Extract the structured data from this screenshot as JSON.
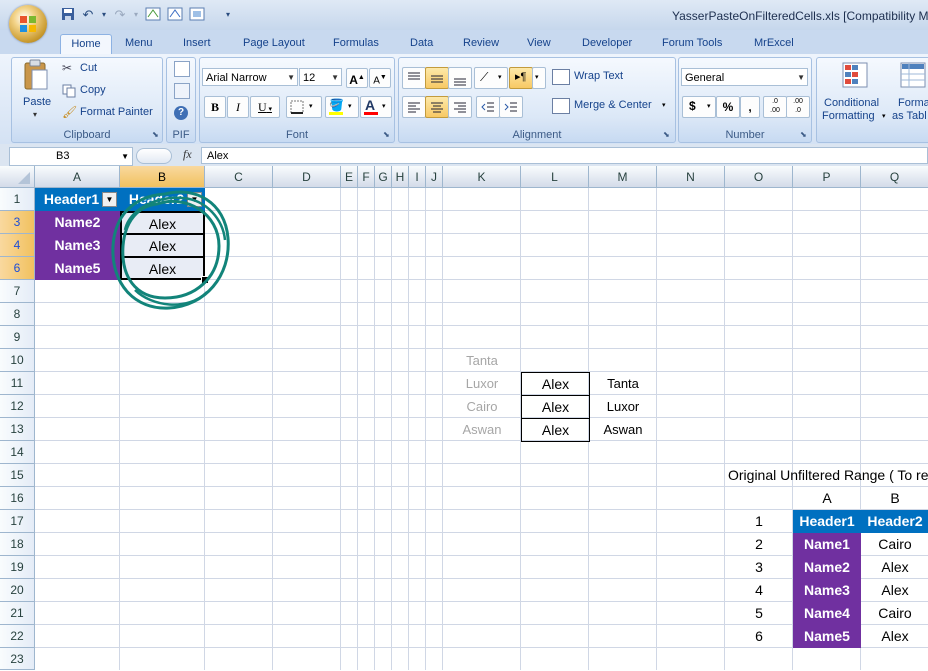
{
  "window": {
    "title": "YasserPasteOnFilteredCells.xls  [Compatibility M"
  },
  "tabs": [
    "Home",
    "Menu",
    "Insert",
    "Page Layout",
    "Formulas",
    "Data",
    "Review",
    "View",
    "Developer",
    "Forum Tools",
    "MrExcel"
  ],
  "active_tab": "Home",
  "ribbon": {
    "clipboard": {
      "paste": "Paste",
      "cut": "Cut",
      "copy": "Copy",
      "format_painter": "Format Painter",
      "label": "Clipboard"
    },
    "pif": {
      "label": "PIF"
    },
    "font": {
      "name": "Arial Narrow",
      "size": "12",
      "label": "Font",
      "bold": "B",
      "italic": "I",
      "underline": "U",
      "grow": "A",
      "shrink": "A",
      "font_color": "A"
    },
    "alignment": {
      "wrap_text": "Wrap Text",
      "merge_center": "Merge & Center",
      "label": "Alignment"
    },
    "number": {
      "format": "General",
      "currency": "$",
      "percent": "%",
      "comma": ",",
      "label": "Number",
      "inc_decimal": ".0 .00",
      "dec_decimal": ".00 .0"
    },
    "styles": {
      "conditional_1": "Conditional",
      "conditional_2": "Formatting",
      "format_as_1": "Format",
      "format_as_2": "as Tabl"
    }
  },
  "formula_bar": {
    "name_box": "B3",
    "fx": "fx",
    "value": "Alex"
  },
  "columns": [
    "A",
    "B",
    "C",
    "D",
    "E",
    "F",
    "G",
    "H",
    "I",
    "J",
    "K",
    "L",
    "M",
    "N",
    "O",
    "P",
    "Q"
  ],
  "selected_column": "B",
  "rows": [
    "1",
    "3",
    "4",
    "6",
    "7",
    "8",
    "9",
    "10",
    "11",
    "12",
    "13",
    "14",
    "15",
    "16",
    "17",
    "18",
    "19",
    "20",
    "21",
    "22",
    "23"
  ],
  "highlighted_rows": [
    "3",
    "4",
    "6"
  ],
  "table": {
    "headers": [
      "Header1",
      "Header2"
    ],
    "rows": [
      [
        "Name2",
        "Alex"
      ],
      [
        "Name3",
        "Alex"
      ],
      [
        "Name5",
        "Alex"
      ]
    ]
  },
  "lookup": {
    "k": [
      "Tanta",
      "Luxor",
      "Cairo",
      "Aswan"
    ],
    "l": [
      "Alex",
      "Alex",
      "Alex"
    ],
    "m": [
      "Tanta",
      "Luxor",
      "Aswan"
    ]
  },
  "original": {
    "title": "Original Unfiltered Range ( To rest",
    "col_labels": [
      "A",
      "B"
    ],
    "row_numbers": [
      "1",
      "2",
      "3",
      "4",
      "5",
      "6"
    ],
    "headers": [
      "Header1",
      "Header2"
    ],
    "rows": [
      [
        "Name1",
        "Cairo"
      ],
      [
        "Name2",
        "Alex"
      ],
      [
        "Name3",
        "Alex"
      ],
      [
        "Name4",
        "Cairo"
      ],
      [
        "Name5",
        "Alex"
      ]
    ]
  },
  "colors": {
    "header_blue": "#0070c0",
    "name_purple": "#7030a0",
    "annotation_teal": "#12847a",
    "selected_header": "#f1c15f"
  }
}
